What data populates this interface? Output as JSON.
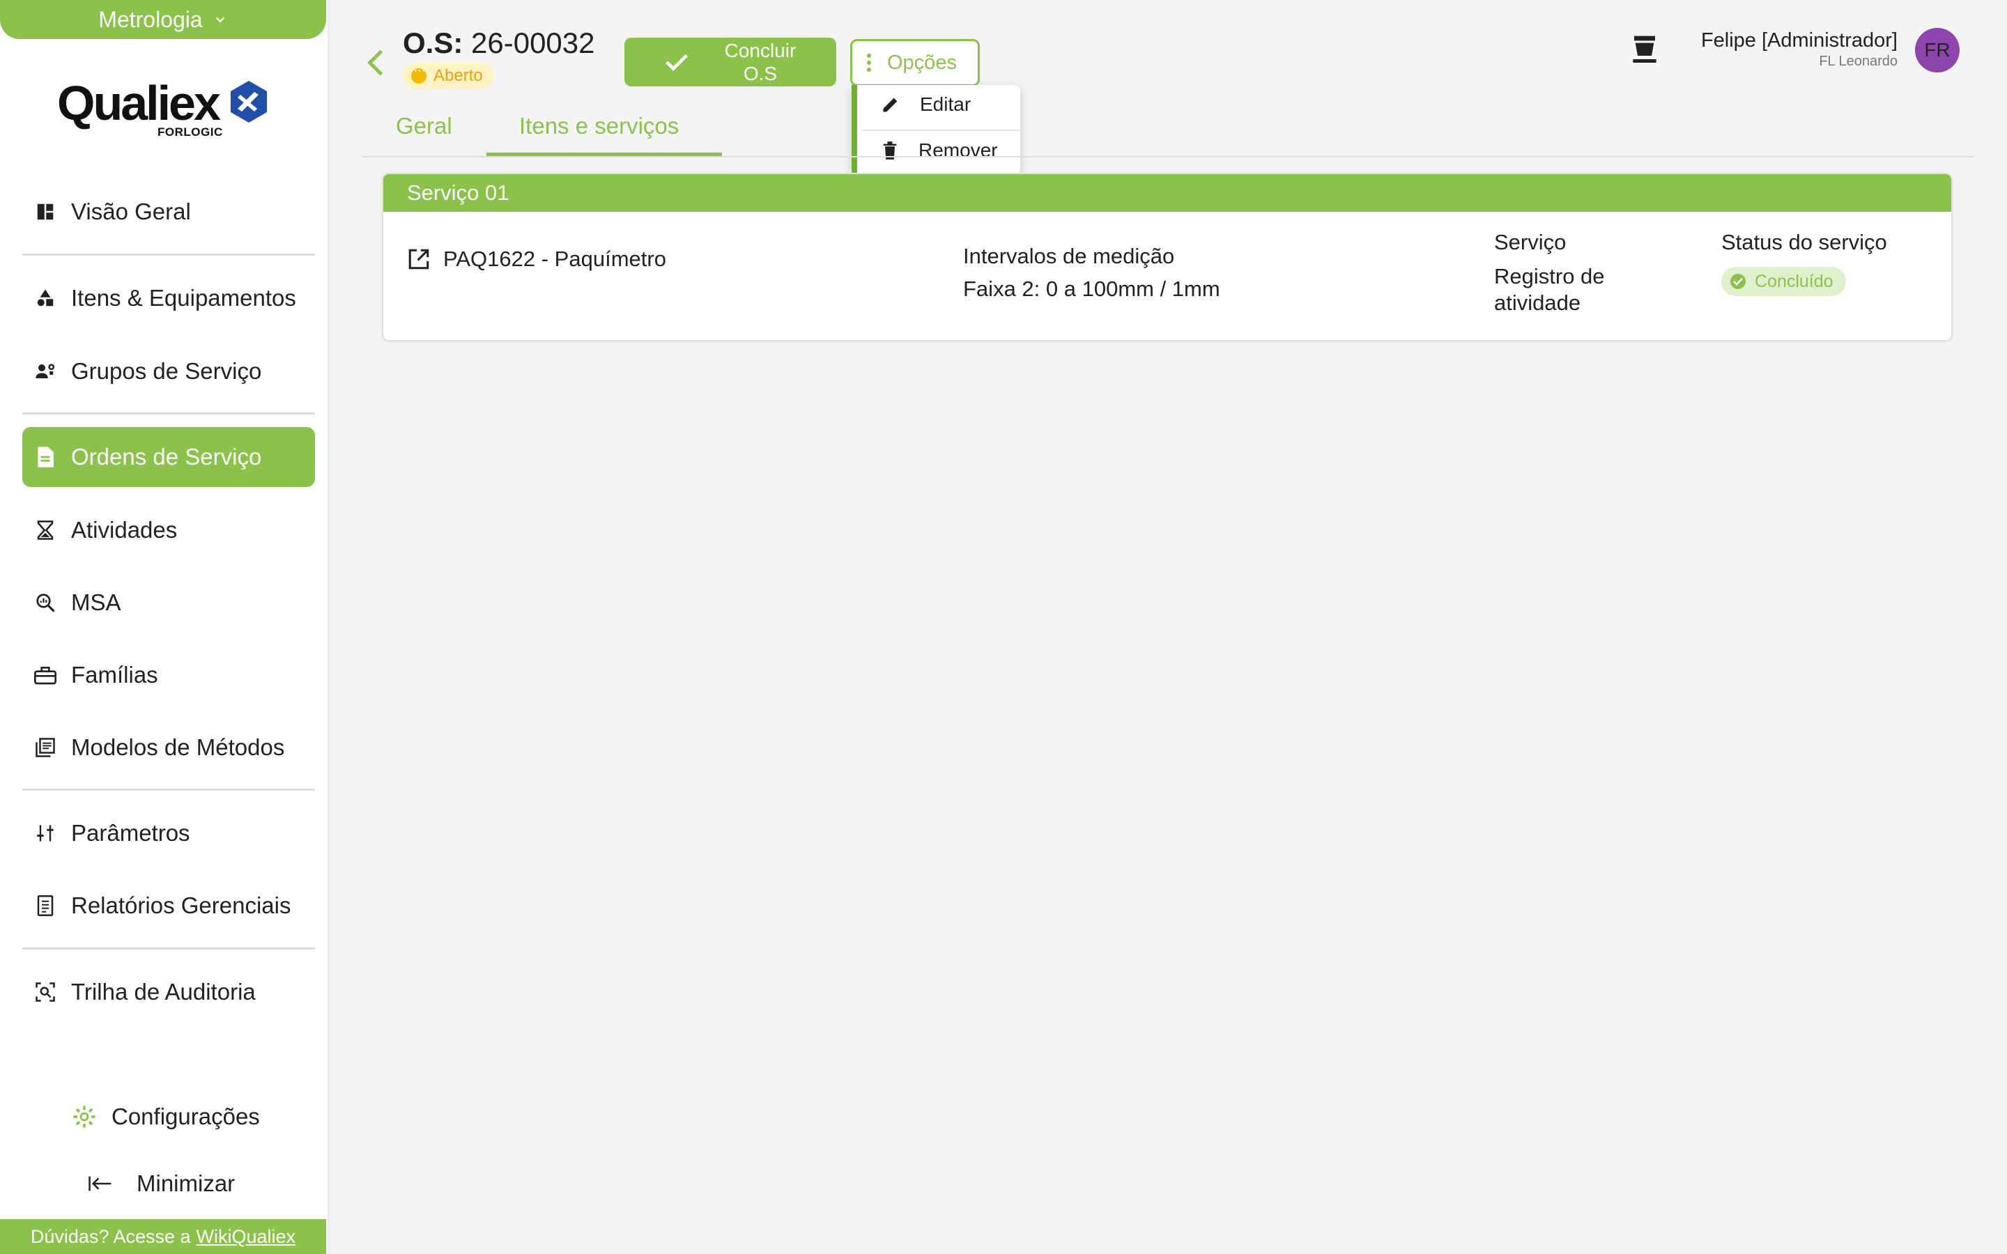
{
  "sidebar": {
    "module": "Metrologia",
    "logo": {
      "name": "Qualiex",
      "sub": "FORLOGIC"
    },
    "items": [
      {
        "label": "Visão Geral",
        "icon": "dashboard-icon"
      },
      {
        "label": "Itens & Equipamentos",
        "icon": "shapes-icon"
      },
      {
        "label": "Grupos de Serviço",
        "icon": "group-settings-icon"
      },
      {
        "label": "Ordens de Serviço",
        "icon": "document-icon",
        "active": true
      },
      {
        "label": "Atividades",
        "icon": "hourglass-icon"
      },
      {
        "label": "MSA",
        "icon": "magnify-chart-icon"
      },
      {
        "label": "Famílias",
        "icon": "toolbox-icon"
      },
      {
        "label": "Modelos de Métodos",
        "icon": "library-icon"
      },
      {
        "label": "Parâmetros",
        "icon": "sliders-icon"
      },
      {
        "label": "Relatórios Gerenciais",
        "icon": "report-icon"
      },
      {
        "label": "Trilha de Auditoria",
        "icon": "audit-scan-icon"
      }
    ],
    "settings_label": "Configurações",
    "minimize_label": "Minimizar",
    "help": {
      "text": "Dúvidas? Acesse a",
      "link": "WikiQualiex"
    }
  },
  "header": {
    "os_prefix": "O.S:",
    "os_number": "26-00032",
    "status": "Aberto",
    "conclude_label_1": "Concluir",
    "conclude_label_2": "O.S",
    "options_label": "Opções",
    "menu": [
      {
        "label": "Editar"
      },
      {
        "label": "Remover"
      }
    ],
    "user_name": "Felipe [Administrador]",
    "user_company": "FL Leonardo",
    "avatar_initials": "FR"
  },
  "tabs": [
    {
      "label": "Geral"
    },
    {
      "label": "Itens e serviços",
      "active": true
    }
  ],
  "service": {
    "title": "Serviço 01",
    "item": "PAQ1622 - Paquímetro",
    "interval_label": "Intervalos de medição",
    "interval_value": "Faixa 2: 0 a 100mm / 1mm",
    "service_label": "Serviço",
    "service_value": "Registro de atividade",
    "status_label": "Status do serviço",
    "status_value": "Concluído"
  },
  "colors": {
    "accent": "#8bc34a",
    "status_open": "#f5b800",
    "avatar": "#8e44ad"
  }
}
